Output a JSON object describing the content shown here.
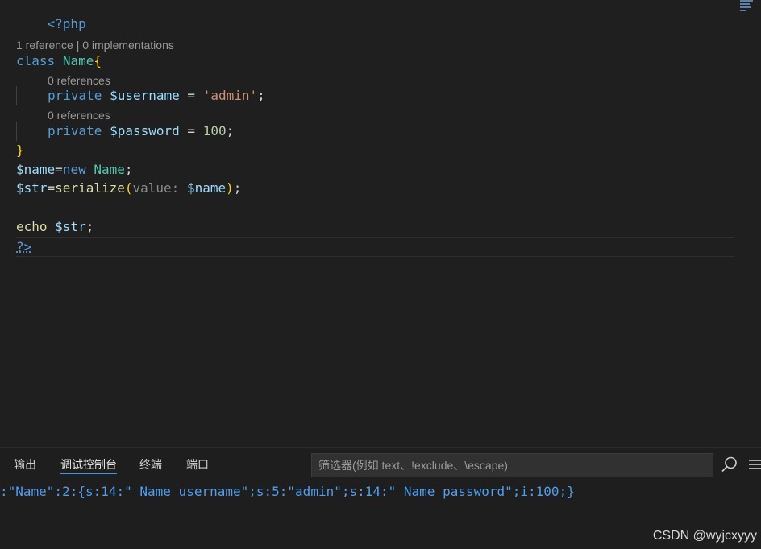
{
  "editor": {
    "open_tag": "<?php",
    "class_lens": "1 reference | 0 implementations",
    "class_kw": "class",
    "class_name": "Name",
    "open_brace": "{",
    "prop1_lens": "0 references",
    "prop1_kw": "private",
    "prop1_var": "$username",
    "prop1_eq": " = ",
    "prop1_val": "'admin'",
    "prop1_end": ";",
    "prop2_lens": "0 references",
    "prop2_kw": "private",
    "prop2_var": "$password",
    "prop2_eq": " = ",
    "prop2_val": "100",
    "prop2_end": ";",
    "close_brace": "}",
    "l6_var": "$name",
    "l6_eq": "=",
    "l6_new": "new",
    "l6_cls": "Name",
    "l6_end": ";",
    "l7_var": "$str",
    "l7_eq": "=",
    "l7_fn": "serialize",
    "l7_po": "(",
    "l7_hint": "value: ",
    "l7_arg": "$name",
    "l7_pc": ")",
    "l7_end": ";",
    "l9_fn": "echo",
    "l9_var": "$str",
    "l9_end": ";",
    "close_tag": "?>"
  },
  "panel": {
    "tabs": [
      {
        "label": "输出"
      },
      {
        "label": "调试控制台"
      },
      {
        "label": "终端"
      },
      {
        "label": "端口"
      }
    ],
    "filter_placeholder": "筛选器(例如 text、!exclude、\\escape)",
    "output_line": ":\"Name\":2:{s:14:\" Name username\";s:5:\"admin\";s:14:\" Name password\";i:100;}"
  },
  "watermark": "CSDN @wyjcxyyy",
  "icons": [
    "search-icon",
    "list-icon"
  ],
  "colors": {
    "background": "#1f1f1f",
    "keyword": "#569cd6",
    "variable": "#9cdcfe",
    "class": "#4ec9b0",
    "string": "#ce9178",
    "number": "#b5cea8",
    "function": "#dcdcaa",
    "output": "#4d9ff0",
    "active_tab_underline": "#3794ff"
  }
}
